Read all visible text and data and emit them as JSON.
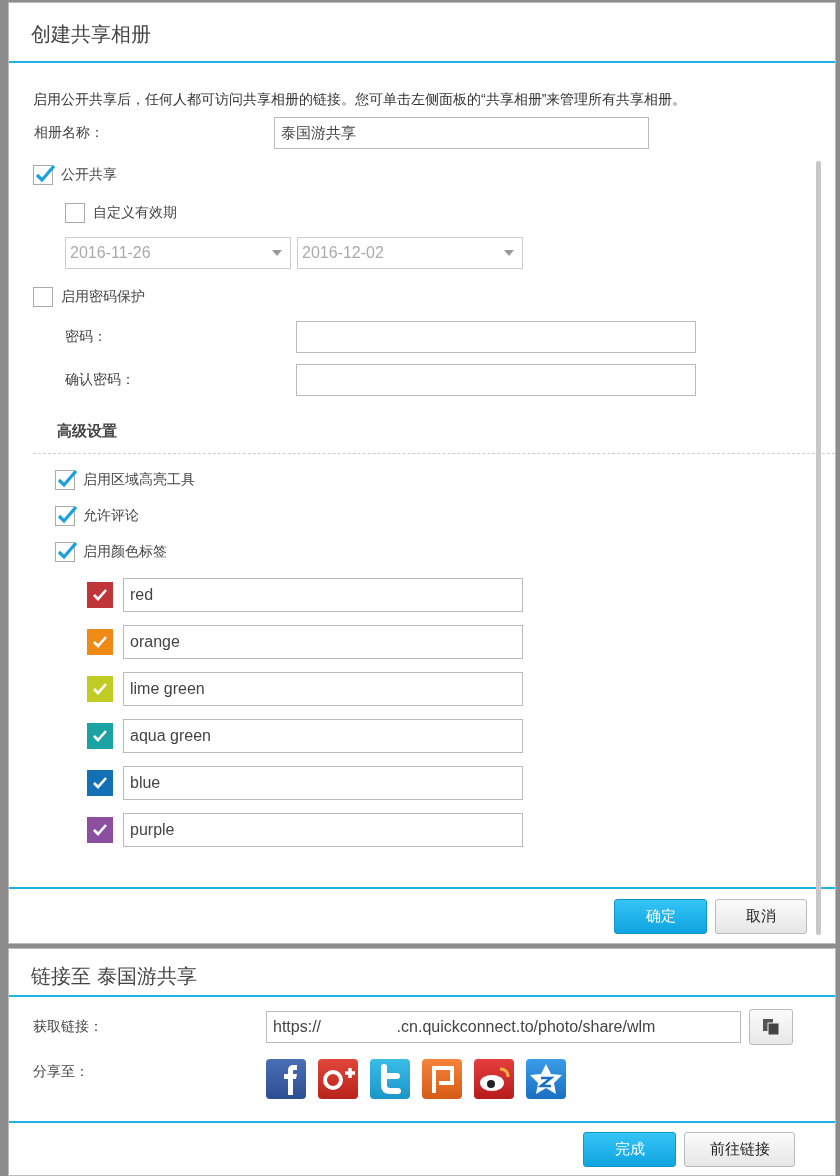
{
  "create_dialog": {
    "title": "创建共享相册",
    "description": "启用公开共享后，任何人都可访问共享相册的链接。您可单击左侧面板的“共享相册”来管理所有共享相册。",
    "album_name": {
      "label": "相册名称：",
      "value": "泰国游共享"
    },
    "public_share": {
      "label": "公开共享",
      "checked": true
    },
    "custom_validity": {
      "label": "自定义有效期",
      "checked": false
    },
    "date_range": [
      {
        "value": "2016-11-26",
        "disabled": true
      },
      {
        "value": "2016-12-02",
        "disabled": true
      }
    ],
    "password_protection": {
      "label": "启用密码保护",
      "checked": false
    },
    "password_fields": [
      {
        "label": "密码："
      },
      {
        "label": "确认密码："
      }
    ],
    "advanced_title": "高级设置",
    "advanced_options": [
      {
        "label": "启用区域高亮工具",
        "checked": true
      },
      {
        "label": "允许评论",
        "checked": true
      },
      {
        "label": "启用颜色标签",
        "checked": true
      }
    ],
    "color_labels": [
      {
        "value": "red",
        "color": "#c0353a",
        "checked": true
      },
      {
        "value": "orange",
        "color": "#ef8a15",
        "checked": true
      },
      {
        "value": "lime green",
        "color": "#c0cb23",
        "checked": true
      },
      {
        "value": "aqua green",
        "color": "#1ba2a3",
        "checked": true
      },
      {
        "value": "blue",
        "color": "#1470b5",
        "checked": true
      },
      {
        "value": "purple",
        "color": "#8c4fa0",
        "checked": true
      }
    ],
    "buttons": [
      {
        "label": "确定",
        "kind": "primary"
      },
      {
        "label": "取消",
        "kind": "secondary"
      }
    ]
  },
  "link_dialog": {
    "title": "链接至 泰国游共享",
    "link": {
      "label": "获取链接：",
      "value": "https://                 .cn.quickconnect.to/photo/share/wlm"
    },
    "share_label": "分享至：",
    "share_targets": [
      {
        "kind": "facebook"
      },
      {
        "kind": "googleplus"
      },
      {
        "kind": "twitter"
      },
      {
        "kind": "plurk"
      },
      {
        "kind": "weibo"
      },
      {
        "kind": "qzone"
      }
    ],
    "buttons": [
      {
        "label": "完成",
        "kind": "primary"
      },
      {
        "label": "前往链接",
        "kind": "secondary"
      }
    ]
  }
}
